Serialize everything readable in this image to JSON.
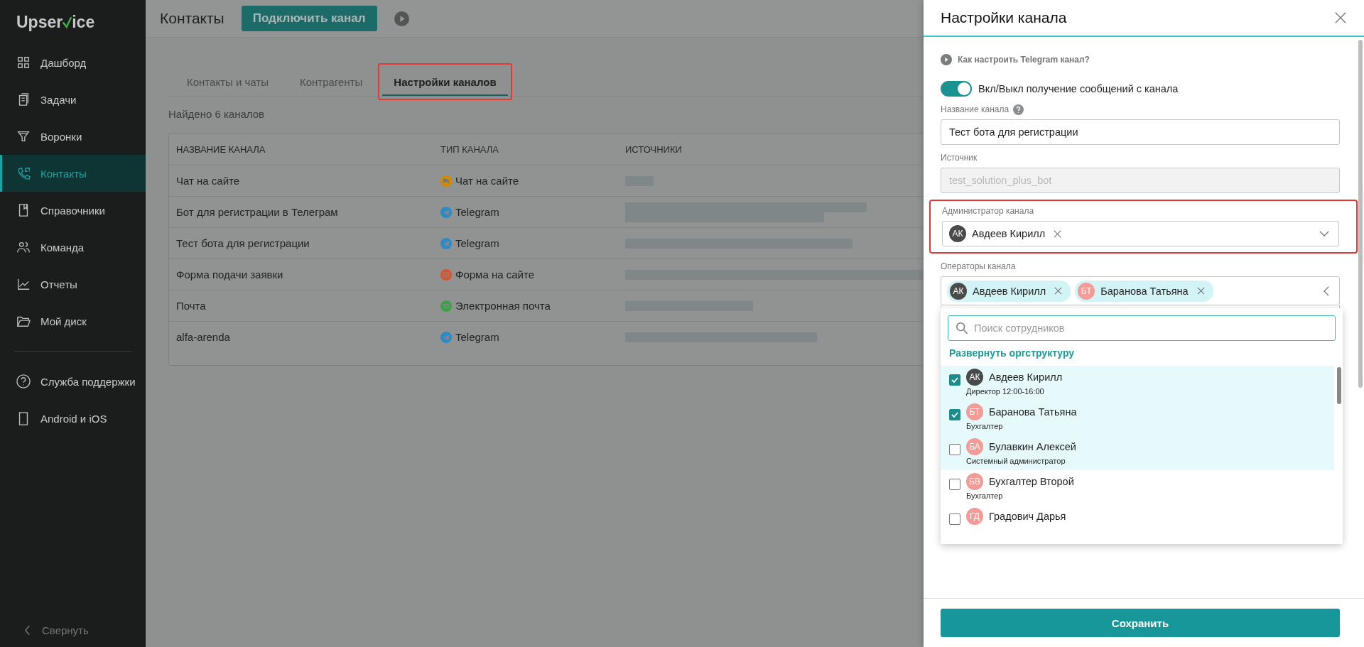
{
  "sidebar": {
    "logo": {
      "before": "Upser",
      "after": "ice"
    },
    "items": [
      {
        "label": "Дашборд",
        "selected": false
      },
      {
        "label": "Задачи",
        "selected": false
      },
      {
        "label": "Воронки",
        "selected": false
      },
      {
        "label": "Контакты",
        "selected": true
      },
      {
        "label": "Справочники",
        "selected": false
      },
      {
        "label": "Команда",
        "selected": false
      },
      {
        "label": "Отчеты",
        "selected": false
      },
      {
        "label": "Мой диск",
        "selected": false
      }
    ],
    "extra": [
      {
        "label": "Служба поддержки"
      },
      {
        "label": "Android и iOS"
      }
    ],
    "collapse": "Свернуть"
  },
  "header": {
    "title": "Контакты",
    "button": "Подключить канал"
  },
  "tabs": [
    {
      "label": "Контакты и чаты",
      "selected": false,
      "highlighted": false
    },
    {
      "label": "Контрагенты",
      "selected": false,
      "highlighted": false
    },
    {
      "label": "Настройки каналов",
      "selected": true,
      "highlighted": true
    }
  ],
  "found": "Найдено 6 каналов",
  "table": {
    "columns": [
      "НАЗВАНИЕ КАНАЛА",
      "ТИП КАНАЛА",
      "ИСТОЧНИКИ"
    ],
    "rows": [
      {
        "name": "Чат на сайте",
        "type": {
          "kind": "chat",
          "label": "Чат на сайте",
          "color": "#d08a00"
        }
      },
      {
        "name": "Бот для регистрации в Телеграм",
        "type": {
          "kind": "telegram",
          "label": "Telegram",
          "color": "#2a8bc8"
        }
      },
      {
        "name": "Тест бота для регистрации",
        "type": {
          "kind": "telegram",
          "label": "Telegram",
          "color": "#2a8bc8"
        }
      },
      {
        "name": "Форма подачи заявки",
        "type": {
          "kind": "form",
          "label": "Форма на сайте",
          "color": "#d9532c"
        }
      },
      {
        "name": "Почта",
        "type": {
          "kind": "mail",
          "label": "Электронная почта",
          "color": "#3ea049"
        }
      },
      {
        "name": "alfa-arenda",
        "type": {
          "kind": "telegram",
          "label": "Telegram",
          "color": "#2a8bc8"
        }
      }
    ]
  },
  "panel": {
    "title": "Настройки канала",
    "help_link": "Как настроить Telegram канал?",
    "toggle": {
      "label": "Вкл/Выкл получение сообщений с канала",
      "on": true
    },
    "name_field": {
      "label": "Название канала",
      "value": "Тест бота для регистрации"
    },
    "source_field": {
      "label": "Источник",
      "value": "test_solution_plus_bot",
      "disabled": true
    },
    "admin": {
      "label": "Администратор канала",
      "highlighted": true,
      "value": {
        "initials": "АК",
        "name": "Авдеев Кирилл",
        "color": "#4a4a4a"
      }
    },
    "operators": {
      "label": "Операторы канала",
      "chips": [
        {
          "initials": "АК",
          "name": "Авдеев Кирилл",
          "color": "#4a4a4a"
        },
        {
          "initials": "БТ",
          "name": "Баранова Татьяна",
          "color": "#f29b97"
        }
      ]
    },
    "dropdown": {
      "placeholder": "Поиск сотрудников",
      "expand_link": "Развернуть оргструктуру",
      "items": [
        {
          "initials": "АК",
          "name": "Авдеев Кирилл",
          "role": "Директор 12:00-16:00",
          "color": "#4a4a4a",
          "checked": true,
          "highlighted": true
        },
        {
          "initials": "БТ",
          "name": "Баранова Татьяна",
          "role": "Бухгалтер",
          "color": "#f29b97",
          "checked": true,
          "highlighted": true
        },
        {
          "initials": "БА",
          "name": "Булавкин Алексей",
          "role": "Системный администратор",
          "color": "#f29b97",
          "checked": false,
          "highlighted": true
        },
        {
          "initials": "БВ",
          "name": "Бухгалтер Второй",
          "role": "Бухгалтер",
          "color": "#f29b97",
          "checked": false,
          "highlighted": false
        },
        {
          "initials": "ГД",
          "name": "Градович Дарья",
          "color": "#f29b97",
          "checked": false,
          "highlighted": false
        }
      ]
    },
    "save": "Сохранить"
  }
}
